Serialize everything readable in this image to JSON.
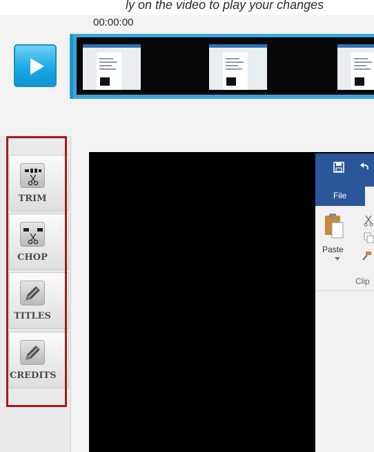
{
  "caption": {
    "text": "ly on the video to play your changes"
  },
  "player": {
    "timecode": "00:00:00"
  },
  "toolbar": {
    "tools": [
      {
        "id": "trim",
        "label": "TRIM",
        "icon": "scissors-trim-icon"
      },
      {
        "id": "chop",
        "label": "CHOP",
        "icon": "scissors-chop-icon"
      },
      {
        "id": "titles",
        "label": "TITLES",
        "icon": "pencil-icon"
      },
      {
        "id": "credits",
        "label": "CREDITS",
        "icon": "pencil-icon"
      }
    ]
  },
  "preview": {
    "word_app": {
      "tab_file": "File",
      "paste_label": "Paste",
      "clipboard_group_label": "Clip"
    }
  },
  "colors": {
    "accent": "#1aa9e6",
    "highlight_border": "#a4191e",
    "ribbon": "#2b579a"
  }
}
